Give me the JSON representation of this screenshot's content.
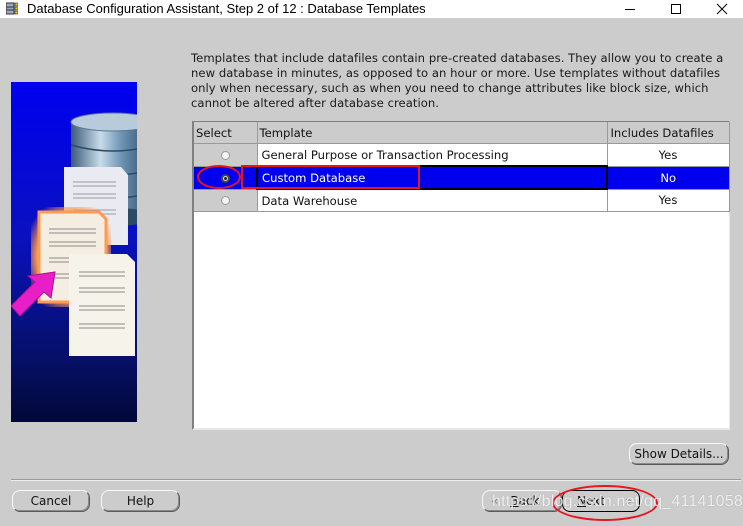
{
  "window": {
    "title": "Database Configuration Assistant, Step 2 of 12 : Database Templates",
    "controls": [
      "minimize",
      "maximize",
      "close"
    ]
  },
  "description": "Templates that include datafiles contain pre-created databases. They allow you to create a new database in minutes, as opposed to an hour or more. Use templates without datafiles only when necessary, such as when you need to change attributes like block size, which cannot be altered after database creation.",
  "table": {
    "columns": [
      "Select",
      "Template",
      "Includes Datafiles"
    ],
    "rows": [
      {
        "selected": false,
        "template": "General Purpose or Transaction Processing",
        "includes_datafiles": "Yes"
      },
      {
        "selected": true,
        "template": "Custom Database",
        "includes_datafiles": "No"
      },
      {
        "selected": false,
        "template": "Data Warehouse",
        "includes_datafiles": "Yes"
      }
    ]
  },
  "buttons": {
    "show_details": "Show Details...",
    "cancel": "Cancel",
    "help": "Help",
    "back_mnemonic": "B",
    "back_rest": "ack",
    "next_mnemonic": "N",
    "next_rest": "ext"
  },
  "colors": {
    "selection": "#0000ee",
    "annotation": "#e8141e",
    "background": "#cccccc"
  },
  "watermark": "https://blog.csdn.net/qq_41141058"
}
